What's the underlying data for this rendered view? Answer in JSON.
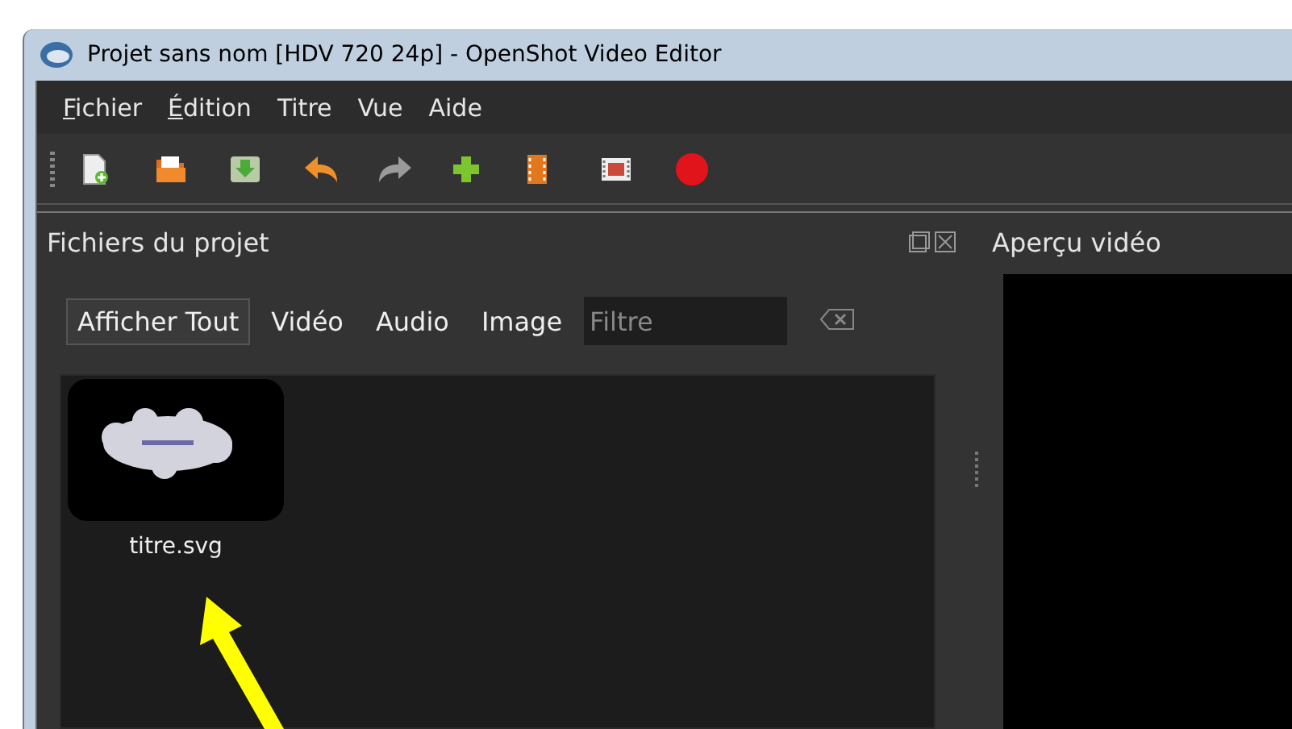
{
  "window": {
    "title": "Projet sans nom [HDV 720 24p] - OpenShot Video Editor"
  },
  "menu": [
    {
      "label": "Fichier",
      "access_key": true
    },
    {
      "label": "Édition",
      "access_key": true
    },
    {
      "label": "Titre",
      "access_key": false
    },
    {
      "label": "Vue",
      "access_key": false
    },
    {
      "label": "Aide",
      "access_key": false
    }
  ],
  "toolbar": [
    {
      "kind": "new"
    },
    {
      "kind": "open"
    },
    {
      "kind": "save"
    },
    {
      "kind": "undo"
    },
    {
      "kind": "redo"
    },
    {
      "kind": "add"
    },
    {
      "kind": "filmstrip"
    },
    {
      "kind": "film"
    },
    {
      "kind": "record"
    }
  ],
  "files_panel": {
    "title": "Fichiers du projet",
    "filters": [
      {
        "label": "Afficher Tout",
        "selected": true
      },
      {
        "label": "Vidéo",
        "selected": false
      },
      {
        "label": "Audio",
        "selected": false
      },
      {
        "label": "Image",
        "selected": false
      }
    ],
    "search": {
      "placeholder": "Filtre"
    },
    "files": [
      {
        "name": "titre.svg"
      }
    ]
  },
  "preview_panel": {
    "title": "Aperçu vidéo"
  }
}
